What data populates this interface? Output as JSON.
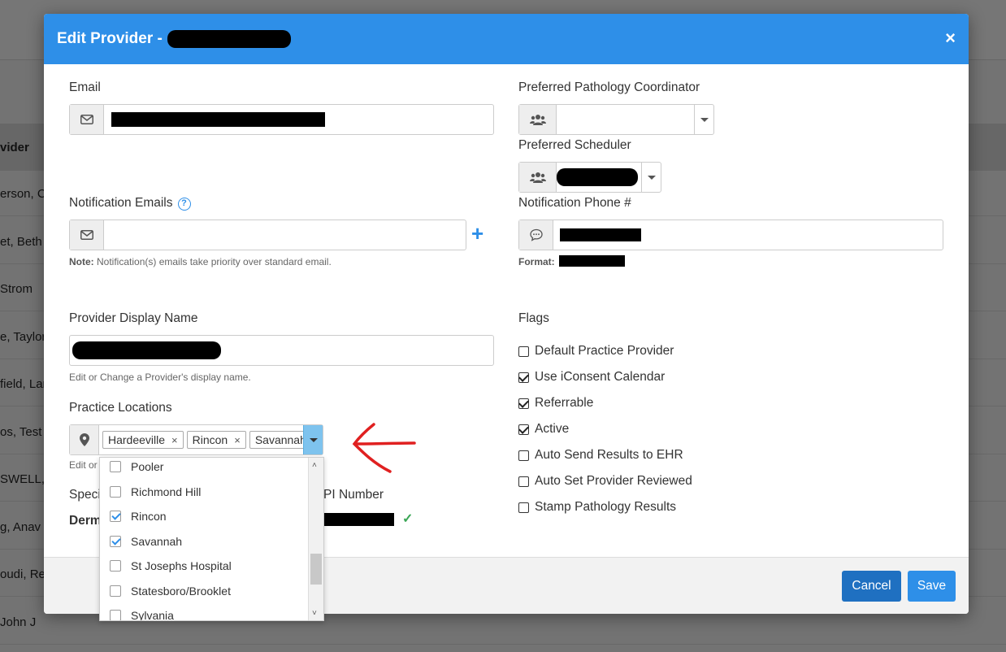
{
  "background": {
    "column_header": "vider",
    "rows": [
      "erson, C",
      "et, Beth",
      "Strom",
      "e, Taylor",
      "field, Lar",
      "os, Test",
      "SWELL, ",
      "g, Anav",
      "oudi, Re",
      "John J"
    ]
  },
  "modal": {
    "title": "Edit Provider -",
    "close_label": "×",
    "email": {
      "label": "Email",
      "value": ""
    },
    "notification_emails": {
      "label": "Notification Emails",
      "help_icon": "?",
      "value": "",
      "add_icon": "+",
      "note_bold": "Note:",
      "note_text": " Notification(s) emails take priority over standard email."
    },
    "display_name": {
      "label": "Provider Display Name",
      "help": "Edit or Change a Provider's display name."
    },
    "practice_locations": {
      "label": "Practice Locations",
      "selected": [
        "Hardeeville",
        "Rincon",
        "Savannah"
      ],
      "remove_label": "×",
      "help_visible": "Edit or",
      "options": [
        {
          "label": "Pooler",
          "checked": false
        },
        {
          "label": "Richmond Hill",
          "checked": false
        },
        {
          "label": "Rincon",
          "checked": true
        },
        {
          "label": "Savannah",
          "checked": true
        },
        {
          "label": "St Josephs Hospital",
          "checked": false
        },
        {
          "label": "Statesboro/Brooklet",
          "checked": false
        },
        {
          "label": "Sylvania",
          "checked": false
        }
      ]
    },
    "specialty": {
      "label_visible": "Speci",
      "value_visible": "Derm"
    },
    "npi": {
      "label_visible": "PI Number",
      "valid_icon": "✓"
    },
    "pathology_coordinator": {
      "label": "Preferred Pathology Coordinator",
      "value": ""
    },
    "scheduler": {
      "label": "Preferred Scheduler"
    },
    "notification_phone": {
      "label": "Notification Phone #",
      "format_label": "Format:"
    },
    "flags": {
      "label": "Flags",
      "items": [
        {
          "label": "Default Practice Provider",
          "checked": false
        },
        {
          "label": "Use iConsent Calendar",
          "checked": true
        },
        {
          "label": "Referrable",
          "checked": true
        },
        {
          "label": "Active",
          "checked": true
        },
        {
          "label": "Auto Send Results to EHR",
          "checked": false
        },
        {
          "label": "Auto Set Provider Reviewed",
          "checked": false
        },
        {
          "label": "Stamp Pathology Results",
          "checked": false
        }
      ]
    },
    "footer": {
      "cancel": "Cancel",
      "save": "Save"
    }
  },
  "colors": {
    "primary": "#2e8fe8",
    "cancel": "#1f70c1",
    "annotation_arrow": "#e02020"
  }
}
